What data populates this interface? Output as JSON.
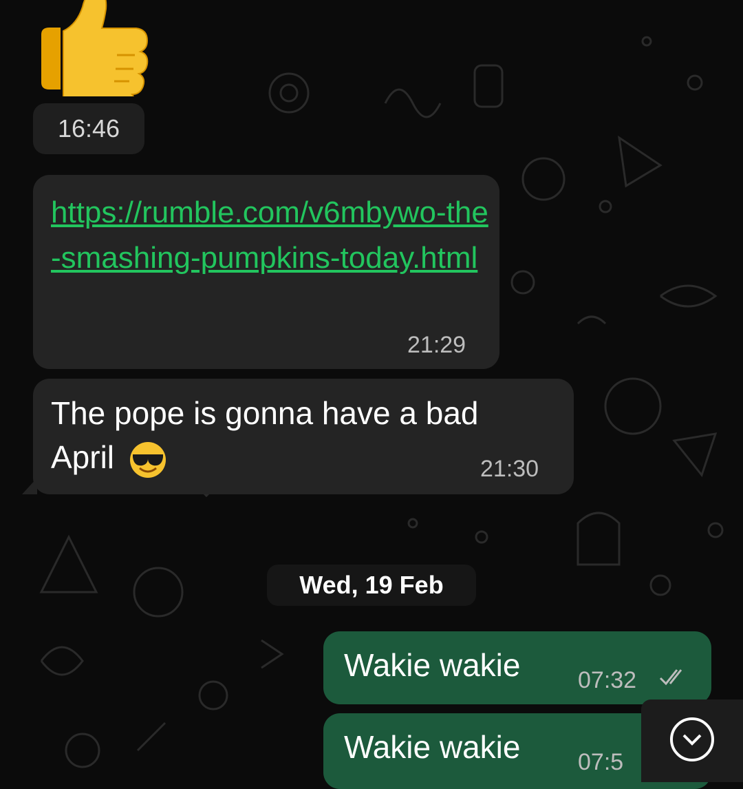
{
  "thumbs_emoji": {
    "icon": "thumbs-up-emoji",
    "time": "16:46"
  },
  "messages": [
    {
      "type": "incoming",
      "text": "https://rumble.com/v6mbywo-the-smashing-pumpkins-today.html",
      "time": "21:29"
    },
    {
      "type": "incoming",
      "text": "The pope is gonna have a bad April",
      "emoji": "smiling-face-with-sunglasses",
      "time": "21:30"
    }
  ],
  "date_separator": "Wed, 19 Feb",
  "outgoing": [
    {
      "text": "Wakie wakie",
      "time": "07:32",
      "status": "read-ticks"
    },
    {
      "text": "Wakie wakie",
      "time": "07:5"
    }
  ],
  "scroll_button": {
    "icon": "chevron-down-circle-icon"
  },
  "colors": {
    "background": "#0b0b0b",
    "incoming_bubble": "#242424",
    "outgoing_bubble": "#1c5a3c",
    "link": "#22c55e",
    "meta_text": "#bdbdbd"
  }
}
